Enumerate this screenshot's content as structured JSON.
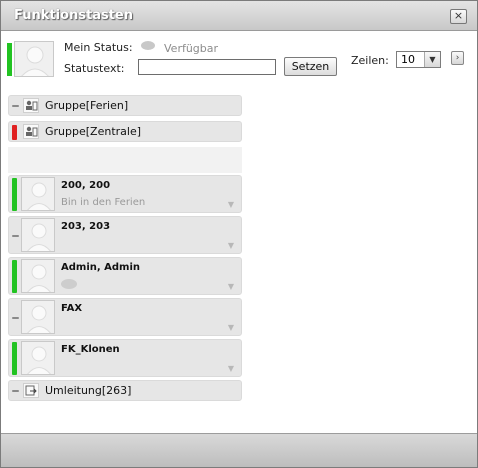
{
  "window": {
    "title": "Funktionstasten",
    "close_glyph": "×"
  },
  "header": {
    "mein_status_label": "Mein Status:",
    "status_value": "Verfügbar",
    "statustext_label": "Statustext:",
    "statustext_value": "",
    "setzen_label": "Setzen",
    "zeilen_label": "Zeilen:",
    "zeilen_value": "10",
    "next_glyph": "›",
    "own_status_color": "#22c322"
  },
  "keys": [
    {
      "type": "group",
      "label": "Gruppe[Ferien]",
      "state": "grey",
      "icon": "group-icon"
    },
    {
      "type": "group",
      "label": "Gruppe[Zentrale]",
      "state": "red",
      "icon": "group-icon"
    },
    {
      "type": "user",
      "label": "200, 200",
      "sub": "Bin in den Ferien",
      "state": "green"
    },
    {
      "type": "user",
      "label": "203, 203",
      "sub": "",
      "state": "grey"
    },
    {
      "type": "user",
      "label": "Admin, Admin",
      "sub": "",
      "state": "green",
      "bubble": true
    },
    {
      "type": "user",
      "label": "FAX",
      "sub": "",
      "state": "grey"
    },
    {
      "type": "user",
      "label": "FK_Klonen",
      "sub": "",
      "state": "green"
    },
    {
      "type": "redirect",
      "label": "Umleitung[263]",
      "state": "grey",
      "icon": "redirect-icon"
    }
  ],
  "chevron_glyph": "▼"
}
